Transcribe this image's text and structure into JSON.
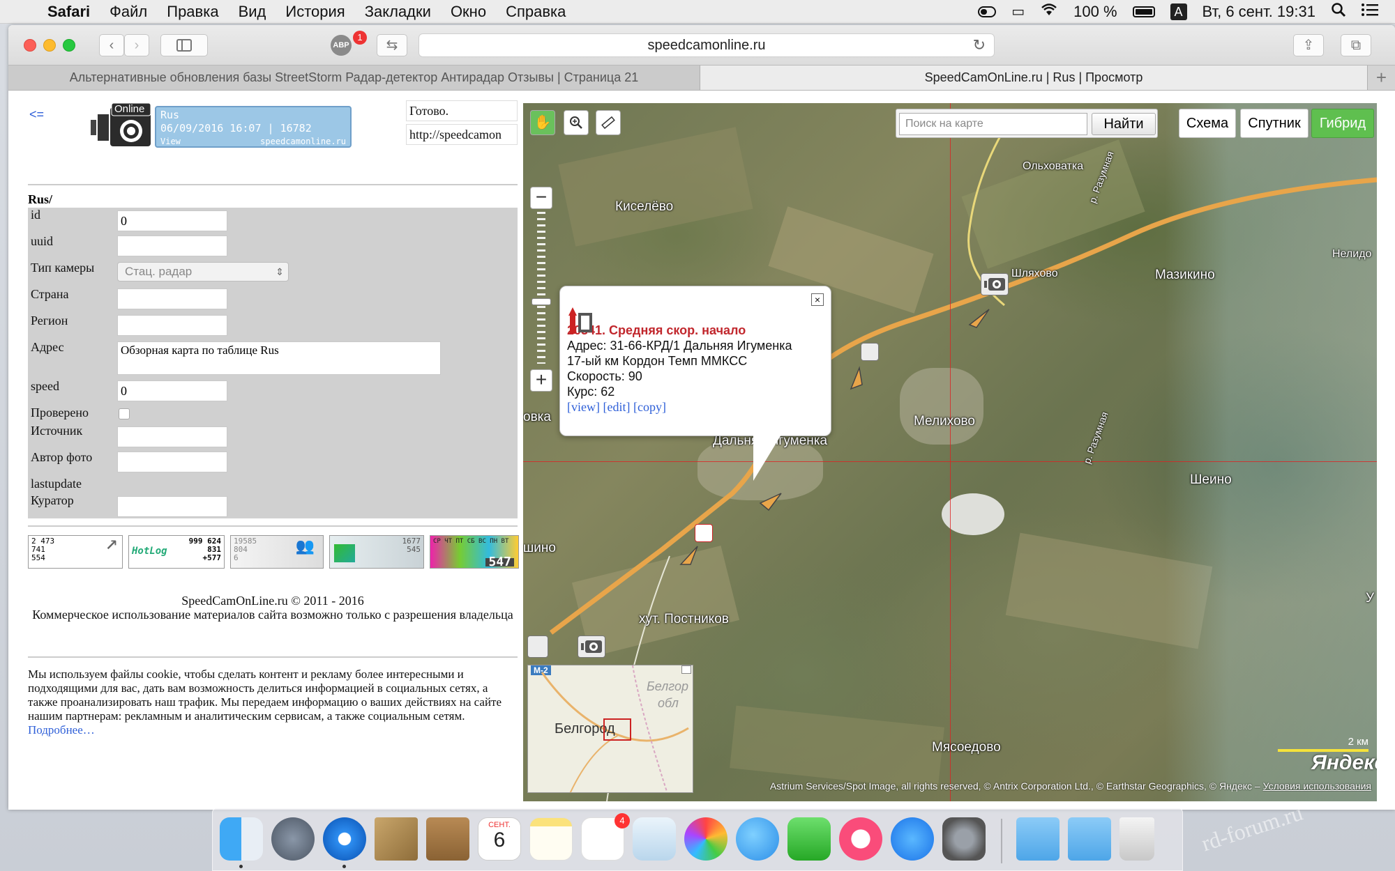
{
  "menubar": {
    "app": "Safari",
    "items": [
      "Файл",
      "Правка",
      "Вид",
      "История",
      "Закладки",
      "Окно",
      "Справка"
    ],
    "battery": "100 %",
    "input_source": "A",
    "datetime": "Вт, 6 сент.  19:31"
  },
  "browser": {
    "url": "speedcamonline.ru",
    "adblock_badge": "1",
    "adblock_label": "ABP",
    "tabs": [
      "Альтернативные обновления базы StreetStorm Радар-детектор Антирадар Отзывы | Страница 21",
      "SpeedCamOnLine.ru | Rus | Просмотр"
    ],
    "new_tab": "+"
  },
  "page": {
    "back_link": "<=",
    "logo": {
      "badge": "Online",
      "line1": "Rus",
      "line2": "06/09/2016 16:07 | 16782",
      "line3": "View",
      "domain": "speedcamonline.ru"
    },
    "status": "Готово.",
    "url_field": "http://speedcamon",
    "form_title": "Rus/",
    "form": {
      "id_label": "id",
      "id_value": "0",
      "uuid_label": "uuid",
      "uuid_value": "",
      "camera_type_label": "Тип камеры",
      "camera_type_value": "Стац. радар",
      "country_label": "Страна",
      "country_value": "",
      "region_label": "Регион",
      "region_value": "",
      "address_label": "Адрес",
      "address_value": "Обзорная карта по таблице Rus",
      "speed_label": "speed",
      "speed_value": "0",
      "checked_label": "Проверено",
      "source_label": "Источник",
      "source_value": "",
      "photo_author_label": "Автор фото",
      "photo_author_value": "",
      "lastupdate_label": "lastupdate",
      "curator_label": "Куратор",
      "curator_value": ""
    },
    "counters": {
      "c1": [
        "2 473",
        "741",
        "554"
      ],
      "c2_brand": "HotLog",
      "c2": [
        "999 624",
        "831",
        "+577"
      ],
      "c3": [
        "19585",
        "804",
        "6"
      ],
      "c4": [
        "1677",
        "545"
      ],
      "c5_days": "СР ЧТ ПТ СБ ВС ПН ВТ",
      "c5_total": "547"
    },
    "copyright": "SpeedCamOnLine.ru © 2011 - 2016",
    "copyright_note": "Коммерческое использование материалов сайта возможно только с разрешения владельца",
    "cookie_text": "Мы используем файлы cookie, чтобы сделать контент и рекламу более интересными и подходящими для вас, дать вам возможность делиться информацией в социальных сетях, а также проанализировать наш трафик. Мы передаем информацию о ваших действиях на сайте нашим партнерам: рекламным и аналитическим сервисам, а также социальным сетям.",
    "cookie_more": "Подробнее…"
  },
  "map": {
    "search_placeholder": "Поиск на карте",
    "search_button": "Найти",
    "types": [
      "Схема",
      "Спутник",
      "Гибрид"
    ],
    "active_type": "Гибрид",
    "labels": {
      "kiselevo": "Киселёво",
      "olkhovatka": "Ольховатка",
      "shlyakhovo": "Шляхово",
      "mazikino": "Мазикино",
      "nelido": "Нелидо",
      "melikhovo": "Мелихово",
      "dalnyaya": "Дальняя Игуменка",
      "sheino": "Шеино",
      "postnikov": "хут. Постников",
      "myasoedovo": "Мясоедово",
      "vka": "овка",
      "shino": "шино",
      "road_razumnaya": "р. Разумная",
      "road_razumnaya2": "р. Разумная",
      "u": "У"
    },
    "popup": {
      "title": "20341. Средняя скор. начало",
      "address": "Адрес: 31-66-КРД/1 Дальняя Игуменка 17-ый км Кордон Темп ММКСС",
      "speed": "Скорость: 90",
      "course": "Курс: 62",
      "links": "[view] [edit] [copy]",
      "close": "×"
    },
    "minimap": {
      "city": "Белгород",
      "region1": "Белгор",
      "region2": "обл",
      "road": "М-2"
    },
    "scale": "2 км",
    "brand": "Яндекс",
    "attribution": "Astrium Services/Spot Image, all rights reserved, © Antrix Corporation Ltd., © Earthstar Geographics, © Яндекс –",
    "terms": "Условия использования"
  },
  "dock": {
    "calendar_month": "СЕНТ.",
    "calendar_day": "6",
    "reminders_badge": "4"
  },
  "watermark": "rd-forum.ru"
}
